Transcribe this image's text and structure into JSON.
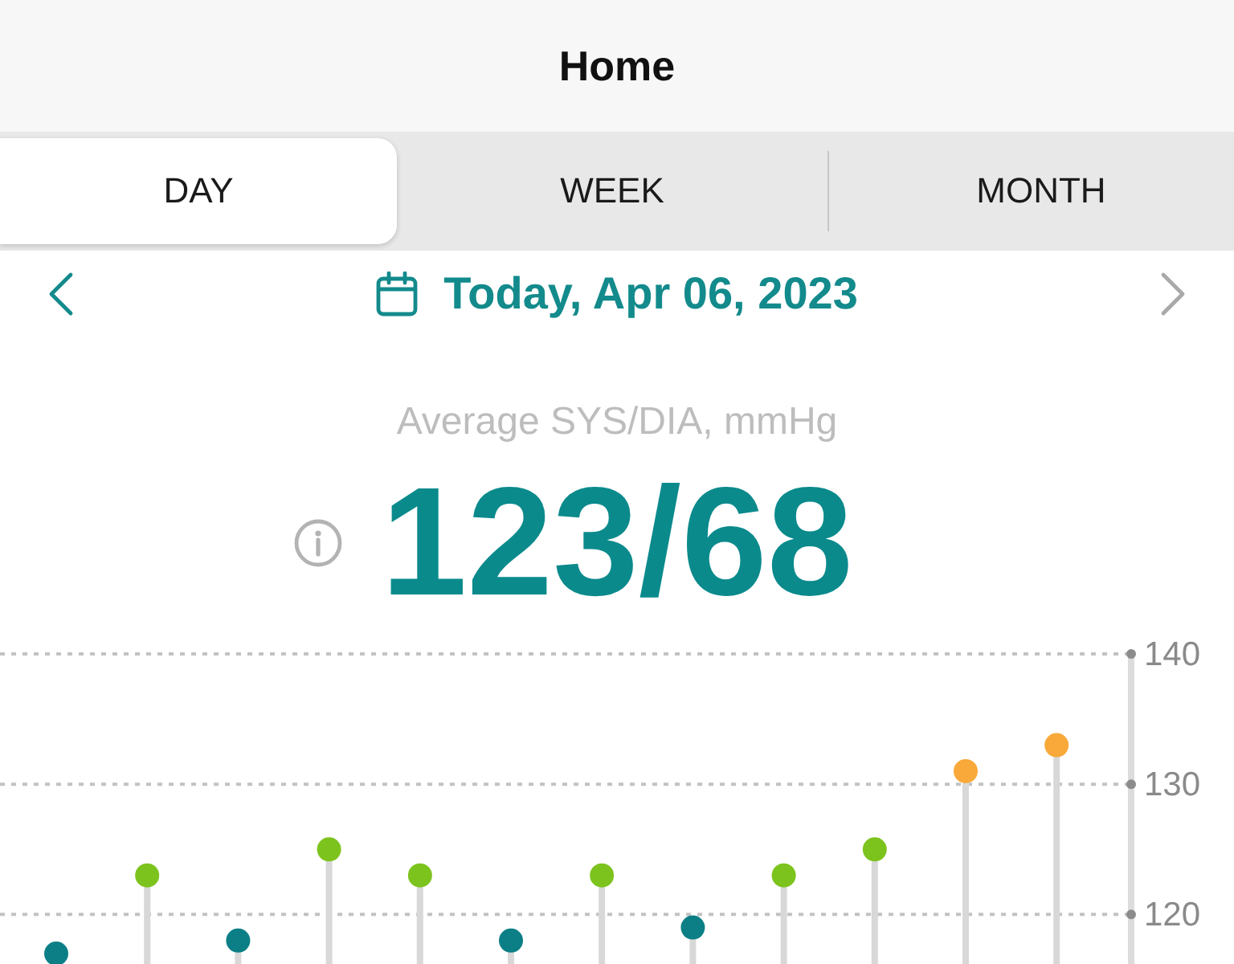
{
  "header": {
    "title": "Home"
  },
  "tabs": [
    {
      "label": "DAY",
      "selected": true
    },
    {
      "label": "WEEK",
      "selected": false
    },
    {
      "label": "MONTH",
      "selected": false
    }
  ],
  "date_nav": {
    "label": "Today, Apr 06, 2023",
    "previous": {
      "disabled": false
    },
    "next": {
      "disabled": true
    }
  },
  "summary": {
    "caption": "Average SYS/DIA, mmHg",
    "value": "123/68"
  },
  "chart": {
    "chart_data": {
      "type": "scatter",
      "grid": true,
      "ylim": [
        116.2,
        140
      ],
      "yticks": [
        120,
        130,
        140
      ],
      "series": [
        {
          "color": "#0c7f86",
          "values": [
            117,
            null,
            118,
            null,
            null,
            118,
            null,
            119,
            null,
            null,
            null,
            null
          ]
        },
        {
          "color": "#7dc31e",
          "values": [
            null,
            123,
            null,
            125,
            123,
            null,
            123,
            null,
            123,
            125,
            null,
            null
          ]
        },
        {
          "color": "#f8a93a",
          "values": [
            null,
            null,
            null,
            null,
            null,
            null,
            null,
            null,
            null,
            null,
            131,
            133
          ]
        }
      ]
    }
  }
}
